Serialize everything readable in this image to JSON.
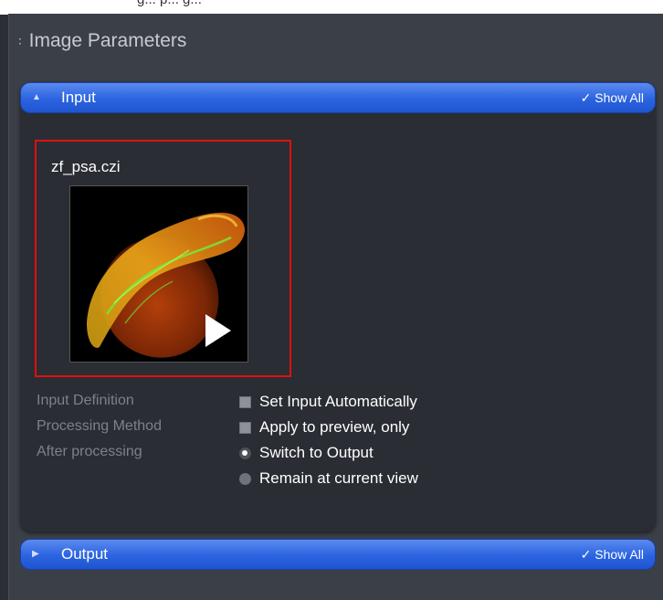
{
  "top_strip_text": "g... p... g...",
  "panel": {
    "title": "Image Parameters",
    "grip_icon": "grip-icon"
  },
  "input_section": {
    "label": "Input",
    "show_all": "Show All",
    "file_name": "zf_psa.czi",
    "play_icon": "play-icon",
    "rows": [
      {
        "label": "Input Definition",
        "option": "Set Input Automatically",
        "control": "checkbox",
        "checked": false
      },
      {
        "label": "Processing Method",
        "option": "Apply to preview, only",
        "control": "checkbox",
        "checked": false
      },
      {
        "label": "After processing",
        "option": "Switch to Output",
        "control": "radio",
        "checked": true
      },
      {
        "label": "",
        "option": "Remain at current view",
        "control": "radio",
        "checked": false
      }
    ]
  },
  "output_section": {
    "label": "Output",
    "show_all": "Show All"
  },
  "colors": {
    "accent_blue": "#2b63e0",
    "highlight_red": "#e01010",
    "panel_bg": "#3b3f47"
  }
}
